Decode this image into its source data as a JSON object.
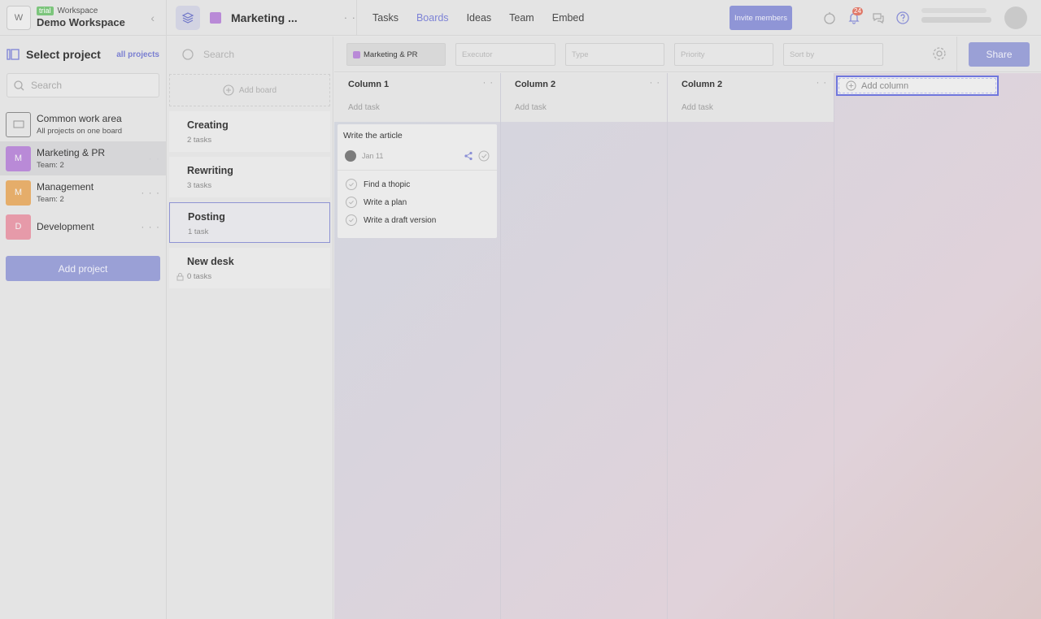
{
  "workspace": {
    "logo_letter": "W",
    "trial_badge": "trial",
    "label": "Workspace",
    "name": "Demo Workspace"
  },
  "sidebar": {
    "select_project": "Select project",
    "all_projects": "all projects",
    "search_placeholder": "Search",
    "projects": [
      {
        "letter": "",
        "name": "Common work area",
        "sub": "All projects on one board",
        "color": "#e4e4e4"
      },
      {
        "letter": "M",
        "name": "Marketing & PR",
        "sub": "Team: 2",
        "color": "#b98ad7"
      },
      {
        "letter": "M",
        "name": "Management",
        "sub": "Team: 2",
        "color": "#e5ad6a"
      },
      {
        "letter": "D",
        "name": "Development",
        "sub": "",
        "color": "#e69aa9"
      }
    ],
    "add_project": "Add project"
  },
  "header": {
    "project_title": "Marketing ...",
    "project_color": "#b98ad7",
    "nav": [
      "Tasks",
      "Boards",
      "Ideas",
      "Team",
      "Embed"
    ],
    "active_nav": "Boards",
    "invite": "Invite members",
    "notifications_count": "24"
  },
  "boards": {
    "search_placeholder": "Search",
    "add_board": "Add board",
    "items": [
      {
        "name": "Creating",
        "count": "2 tasks"
      },
      {
        "name": "Rewriting",
        "count": "3 tasks"
      },
      {
        "name": "Posting",
        "count": "1 task"
      },
      {
        "name": "New desk",
        "count": "0 tasks"
      }
    ]
  },
  "filters": {
    "project": "Marketing & PR",
    "executor": "Executor",
    "type": "Type",
    "priority": "Priority",
    "sort_by": "Sort by",
    "share": "Share"
  },
  "columns": [
    {
      "title": "Column 1",
      "add_task": "Add task"
    },
    {
      "title": "Column 2",
      "add_task": "Add task"
    },
    {
      "title": "Column 2",
      "add_task": "Add task"
    }
  ],
  "add_column": "Add column",
  "card": {
    "title": "Write the article",
    "date": "Jan 11",
    "subtasks": [
      "Find a thopic",
      "Write a plan",
      "Write a draft version"
    ]
  },
  "colors": {
    "accent": "#7d83d6",
    "button": "#9aa0d6"
  }
}
